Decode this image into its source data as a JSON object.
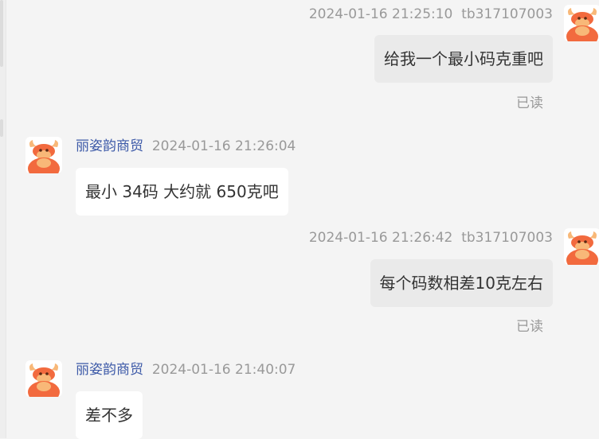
{
  "colors": {
    "background": "#f4f4f4",
    "sent_bubble": "#eaeaea",
    "received_bubble": "#ffffff",
    "sender_name": "#3d5aa8",
    "meta_text": "#999999",
    "avatar_primary": "#f26a3e",
    "avatar_secondary": "#f8b878"
  },
  "messages": [
    {
      "direction": "outgoing",
      "timestamp": "2024-01-16 21:25:10",
      "user": "tb317107003",
      "text": "给我一个最小码克重吧",
      "status": "已读",
      "avatar_icon": "bull-mascot-icon"
    },
    {
      "direction": "incoming",
      "sender": "丽姿韵商贸",
      "timestamp": "2024-01-16 21:26:04",
      "text": "最小 34码  大约就 650克吧",
      "avatar_icon": "bull-mascot-icon"
    },
    {
      "direction": "outgoing",
      "timestamp": "2024-01-16 21:26:42",
      "user": "tb317107003",
      "text": "每个码数相差10克左右",
      "status": "已读",
      "avatar_icon": "bull-mascot-icon"
    },
    {
      "direction": "incoming",
      "sender": "丽姿韵商贸",
      "timestamp": "2024-01-16 21:40:07",
      "text": "差不多",
      "avatar_icon": "bull-mascot-icon"
    }
  ]
}
